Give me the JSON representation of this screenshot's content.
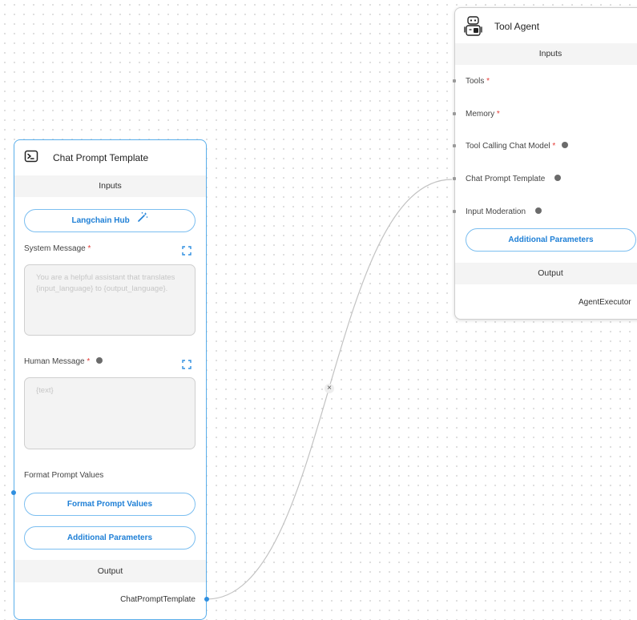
{
  "chat_prompt_node": {
    "title": "Chat Prompt Template",
    "icon": "terminal-prompt-icon",
    "inputs_label": "Inputs",
    "langchain_hub_label": "Langchain Hub",
    "system_message": {
      "label": "System Message",
      "required_mark": "*",
      "placeholder": "You are a helpful assistant that translates {input_language} to {output_language}."
    },
    "human_message": {
      "label": "Human Message",
      "required_mark": "*",
      "placeholder": "{text}"
    },
    "format_prompt_values_label": "Format Prompt Values",
    "format_prompt_values_button": "Format Prompt Values",
    "additional_parameters_button": "Additional Parameters",
    "output_label": "Output",
    "output_name": "ChatPromptTemplate"
  },
  "tool_agent_node": {
    "title": "Tool Agent",
    "icon": "robot-icon",
    "inputs_label": "Inputs",
    "inputs": [
      {
        "label": "Tools",
        "required_mark": "*",
        "info": false
      },
      {
        "label": "Memory",
        "required_mark": "*",
        "info": false
      },
      {
        "label": "Tool Calling Chat Model",
        "required_mark": "*",
        "info": true
      },
      {
        "label": "Chat Prompt Template",
        "required_mark": "",
        "info": true
      },
      {
        "label": "Input Moderation",
        "required_mark": "",
        "info": true
      }
    ],
    "additional_parameters_button": "Additional Parameters",
    "output_label": "Output",
    "output_name": "AgentExecutor"
  },
  "edge": {
    "from": "ChatPromptTemplate",
    "to": "Chat Prompt Template",
    "delete_glyph": "×"
  }
}
